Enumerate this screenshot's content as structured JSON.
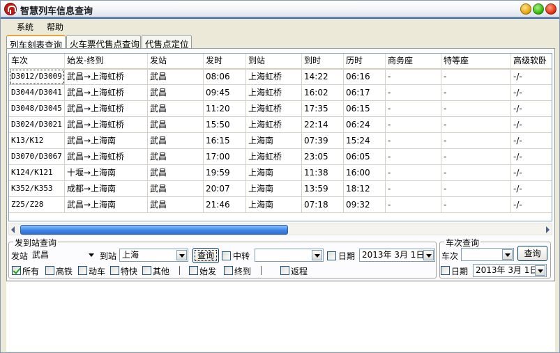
{
  "window": {
    "title": "智慧列车信息查询"
  },
  "menu": [
    "系统",
    "帮助"
  ],
  "tabs": [
    {
      "label": "列车刻表查询",
      "active": true
    },
    {
      "label": "火车票代售点查询",
      "active": false
    },
    {
      "label": "代售点定位",
      "active": false
    }
  ],
  "table": {
    "columns": [
      "车次",
      "始发-终到",
      "发站",
      "发时",
      "到站",
      "到时",
      "历时",
      "商务座",
      "特等座",
      "高级软卧"
    ],
    "rows": [
      [
        "D3012/D3009",
        "武昌→上海虹桥",
        "武昌",
        "08:06",
        "上海虹桥",
        "14:22",
        "06:16",
        "-",
        "-",
        "-/-"
      ],
      [
        "D3044/D3041",
        "武昌→上海虹桥",
        "武昌",
        "09:45",
        "上海虹桥",
        "16:02",
        "06:17",
        "-",
        "-",
        "-/-"
      ],
      [
        "D3048/D3045",
        "武昌→上海虹桥",
        "武昌",
        "11:20",
        "上海虹桥",
        "17:35",
        "06:15",
        "-",
        "-",
        "-/-"
      ],
      [
        "D3024/D3021",
        "武昌→上海虹桥",
        "武昌",
        "15:50",
        "上海虹桥",
        "22:14",
        "06:24",
        "-",
        "-",
        "-/-"
      ],
      [
        "K13/K12",
        "武昌→上海南",
        "武昌",
        "16:15",
        "上海南",
        "07:39",
        "15:24",
        "-",
        "-",
        "-/-"
      ],
      [
        "D3070/D3067",
        "武昌→上海虹桥",
        "武昌",
        "17:00",
        "上海虹桥",
        "23:05",
        "06:05",
        "-",
        "-",
        "-/-"
      ],
      [
        "K124/K121",
        "十堰→上海南",
        "武昌",
        "19:59",
        "上海南",
        "11:38",
        "16:00",
        "-",
        "-",
        "-/-"
      ],
      [
        "K352/K353",
        "成都→上海南",
        "武昌",
        "20:07",
        "上海南",
        "13:59",
        "18:12",
        "-",
        "-",
        "-/-"
      ],
      [
        "Z25/Z28",
        "武昌→上海南",
        "武昌",
        "21:46",
        "上海南",
        "07:18",
        "09:32",
        "-",
        "-",
        "-/-"
      ]
    ]
  },
  "station_query": {
    "title": "发到站查询",
    "from_label": "发站",
    "from_value": "武昌",
    "to_label": "到站",
    "to_value": "上海",
    "query_button": "查询",
    "transfer_label": "中转",
    "transfer_value": "",
    "date_label": "日期",
    "date_value": "2013年 3月 1日",
    "filters": {
      "all": "所有",
      "high_speed": "高铁",
      "emu": "动车",
      "express": "特快",
      "other": "其他",
      "origin": "始发",
      "terminal": "终到",
      "return": "返程"
    }
  },
  "train_query": {
    "title": "车次查询",
    "train_label": "车次",
    "train_value": "",
    "query_button": "查询",
    "date_label": "日期",
    "date_value": "2013年 3月 1日"
  }
}
